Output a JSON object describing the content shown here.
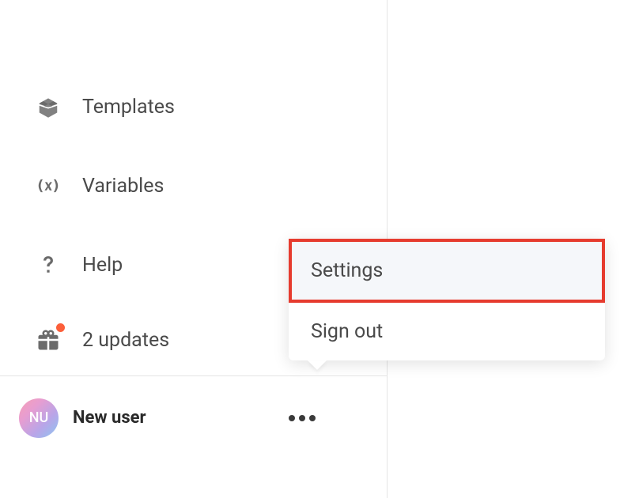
{
  "sidebar": {
    "items": [
      {
        "icon": "box-open-icon",
        "label": "Templates"
      },
      {
        "icon": "variable-icon",
        "label": "Variables"
      },
      {
        "icon": "question-icon",
        "label": "Help"
      },
      {
        "icon": "gift-icon",
        "label": "2 updates",
        "badge": true
      }
    ]
  },
  "user": {
    "initials": "NU",
    "name": "New user"
  },
  "popup": {
    "items": [
      {
        "label": "Settings",
        "highlighted": true
      },
      {
        "label": "Sign out",
        "highlighted": false
      }
    ]
  },
  "highlight_color": "#e63b2e"
}
